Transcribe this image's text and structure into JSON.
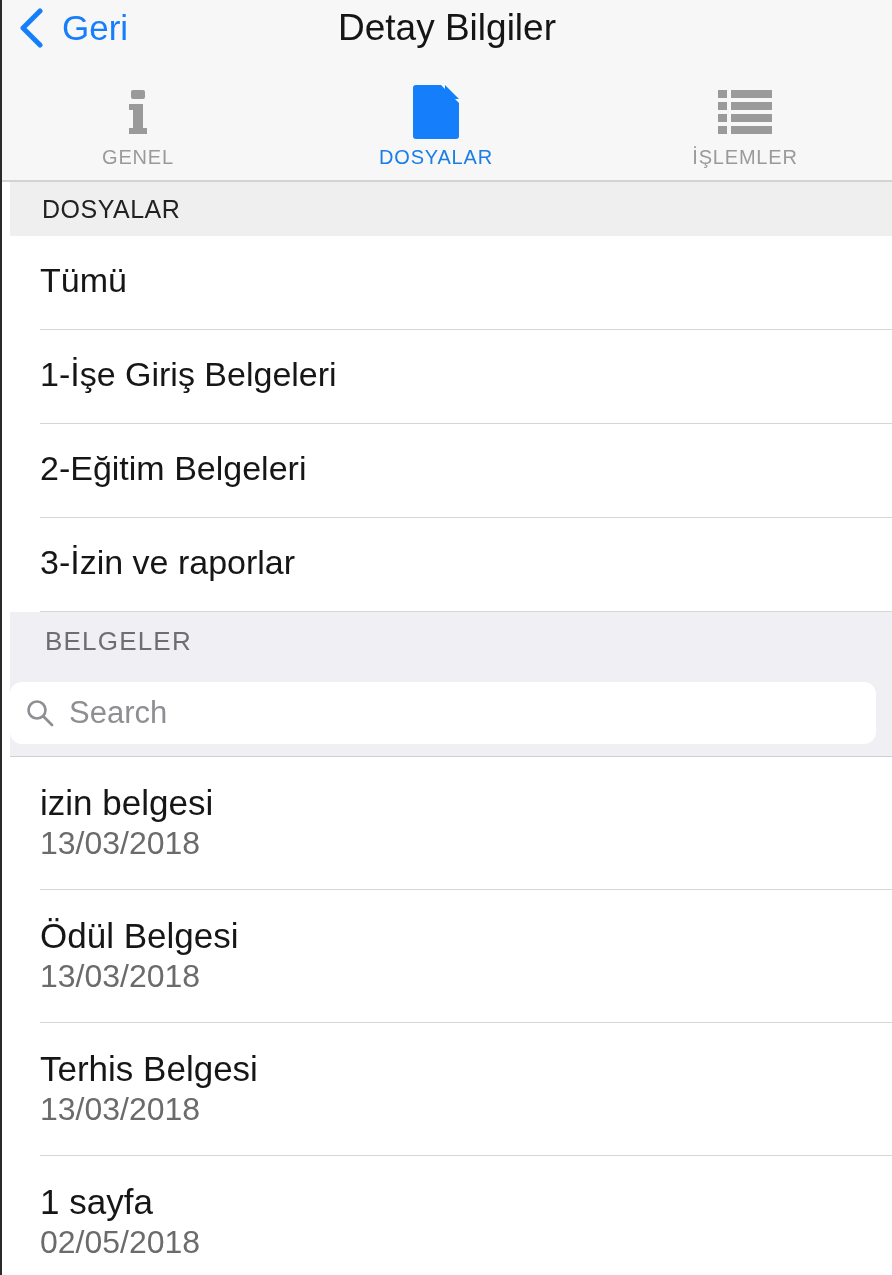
{
  "nav": {
    "back_label": "Geri",
    "title": "Detay Bilgiler"
  },
  "tabs": [
    {
      "label": "GENEL",
      "selected": false
    },
    {
      "label": "DOSYALAR",
      "selected": true
    },
    {
      "label": "İŞLEMLER",
      "selected": false
    }
  ],
  "folders": {
    "header": "DOSYALAR",
    "items": [
      "Tümü",
      "1-İşe Giriş Belgeleri",
      "2-Eğitim Belgeleri",
      "3-İzin ve raporlar"
    ]
  },
  "documents": {
    "header": "BELGELER",
    "search": {
      "placeholder": "Search"
    },
    "items": [
      {
        "title": "izin belgesi",
        "date": "13/03/2018"
      },
      {
        "title": "Ödül Belgesi",
        "date": "13/03/2018"
      },
      {
        "title": "Terhis Belgesi",
        "date": "13/03/2018"
      },
      {
        "title": "1 sayfa",
        "date": "02/05/2018"
      }
    ]
  }
}
